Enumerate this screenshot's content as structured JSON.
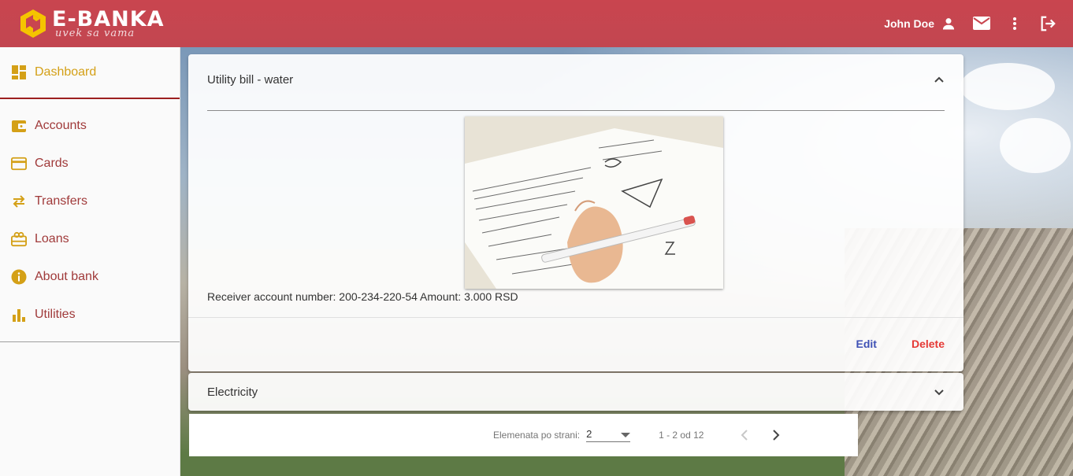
{
  "header": {
    "logo_title": "E-BANKA",
    "logo_subtitle": "uvek sa vama",
    "user_name": "John Doe",
    "icons": [
      "account-icon",
      "mail-icon",
      "more-vert-icon",
      "logout-icon"
    ]
  },
  "sidebar": {
    "items": [
      {
        "label": "Dashboard",
        "icon": "dashboard-icon",
        "active": true
      },
      {
        "label": "Accounts",
        "icon": "wallet-icon"
      },
      {
        "label": "Cards",
        "icon": "credit-card-icon"
      },
      {
        "label": "Transfers",
        "icon": "swap-arrows-icon"
      },
      {
        "label": "Loans",
        "icon": "gift-card-icon"
      },
      {
        "label": "About bank",
        "icon": "info-icon"
      },
      {
        "label": "Utilities",
        "icon": "bar-chart-icon"
      }
    ]
  },
  "panels": [
    {
      "title": "Utility bill - water",
      "expanded": true,
      "details": "Receiver account number: 200-234-220-54 Amount: 3.000 RSD",
      "edit_label": "Edit",
      "delete_label": "Delete"
    },
    {
      "title": "Electricity",
      "expanded": false
    }
  ],
  "paginator": {
    "page_size_label": "Elemenata po strani:",
    "page_size_value": "2",
    "range_label": "1 - 2 od 12"
  },
  "colors": {
    "topbar": "#c9454f",
    "nav_text": "#a03a3a",
    "nav_active": "#d4a017",
    "edit": "#3f51b5",
    "delete": "#e53935"
  }
}
